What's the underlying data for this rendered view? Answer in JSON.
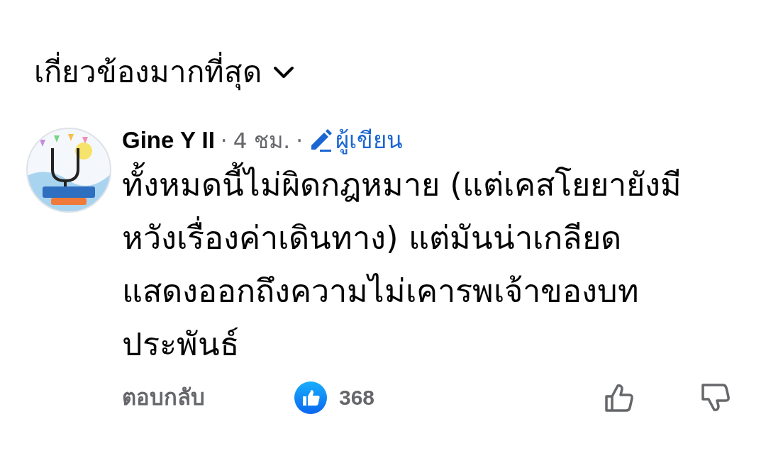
{
  "sort": {
    "label": "เกี่ยวข้องมากที่สุด"
  },
  "comment": {
    "author": "Gine Y II",
    "separator_1": "·",
    "time": "4 ชม.",
    "separator_2": "·",
    "badge": "ผู้เขียน",
    "lines": [
      "ทั้งหมดนี้ไม่ผิดกฎหมาย (แต่เคสโยยายังมี",
      "หวังเรื่องค่าเดินทาง) แต่มันน่าเกลียด",
      "แสดงออกถึงความไม่เคารพเจ้าของบท",
      "ประพันธ์"
    ],
    "reply_label": "ตอบกลับ",
    "like_count": "368",
    "liked": false,
    "disliked": false
  }
}
